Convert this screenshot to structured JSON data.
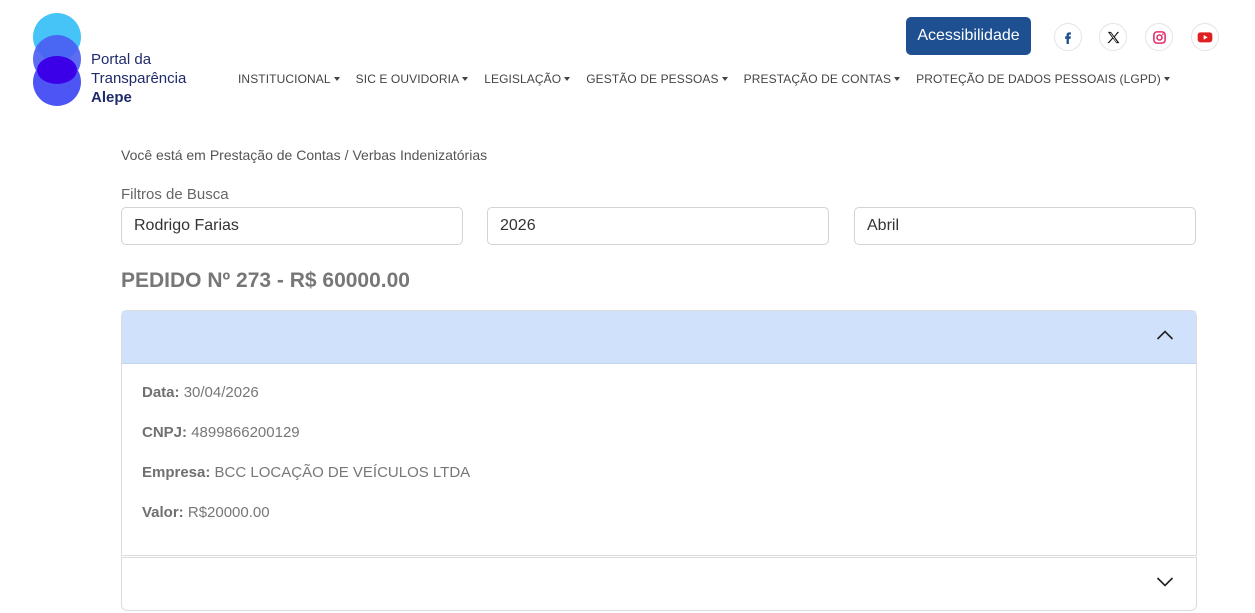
{
  "brand": {
    "line1": "Portal da",
    "line2": "Transparência",
    "line3": "Alepe",
    "colors": {
      "light": "#46c3f7",
      "mid": "#4a5df2",
      "dark": "#3b00e8"
    }
  },
  "nav": [
    {
      "label": "INSTITUCIONAL"
    },
    {
      "label": "SIC E OUVIDORIA"
    },
    {
      "label": "LEGISLAÇÃO"
    },
    {
      "label": "GESTÃO DE PESSOAS"
    },
    {
      "label": "PRESTAÇÃO DE CONTAS"
    },
    {
      "label": "PROTEÇÃO DE DADOS PESSOAIS (LGPD)"
    }
  ],
  "accessibility_label": "Acessibilidade",
  "social": [
    {
      "icon": "facebook-icon",
      "color": "#1d4f91"
    },
    {
      "icon": "x-icon",
      "color": "#111111"
    },
    {
      "icon": "instagram-icon",
      "color": "#e1306c"
    },
    {
      "icon": "youtube-icon",
      "color": "#e02020"
    }
  ],
  "breadcrumb": {
    "prefix": "Você está em",
    "section": "Prestação de Contas",
    "separator": "/",
    "page": "Verbas Indenizatórias"
  },
  "filters": {
    "title": "Filtros de Busca",
    "name": "Rodrigo Farias",
    "year": "2026",
    "month": "Abril"
  },
  "order": {
    "title": "PEDIDO Nº 273 - R$ 60000.00",
    "item": {
      "date_label": "Data:",
      "date": "30/04/2026",
      "cnpj_label": "CNPJ:",
      "cnpj": "4899866200129",
      "company_label": "Empresa:",
      "company": "BCC LOCAÇÃO DE VEÍCULOS LTDA",
      "value_label": "Valor:",
      "value": "R$20000.00"
    }
  },
  "colors": {
    "primary": "#1d4f91",
    "accordion_header": "#d0e1fb"
  }
}
